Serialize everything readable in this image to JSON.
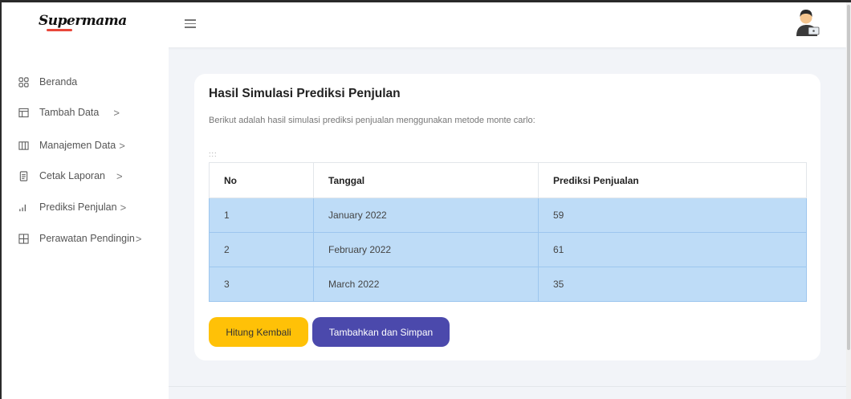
{
  "brand": {
    "logo_text": "Supermama",
    "accent": "#e8473a"
  },
  "topbar": {
    "menu_icon": "hamburger-icon",
    "avatar_icon": "user-avatar-icon"
  },
  "sidebar": {
    "items": [
      {
        "label": "Beranda",
        "icon": "grid-icon",
        "chevron": ""
      },
      {
        "label": "Tambah Data",
        "icon": "layout-icon",
        "chevron": ">"
      },
      {
        "label": "Manajemen Data",
        "icon": "columns-icon",
        "chevron": ">"
      },
      {
        "label": "Cetak Laporan",
        "icon": "document-icon",
        "chevron": ">"
      },
      {
        "label": "Prediksi Penjulan",
        "icon": "bar-chart-icon",
        "chevron": ">"
      },
      {
        "label": "Perawatan Pendingin",
        "icon": "table-grid-icon",
        "chevron": ">"
      }
    ]
  },
  "main": {
    "title": "Hasil Simulasi Prediksi Penjulan",
    "subtitle": "Berikut adalah hasil simulasi prediksi penjualan menggunakan metode monte carlo:",
    "drag_handle": ":::",
    "table": {
      "headers": [
        "No",
        "Tanggal",
        "Prediksi Penjualan"
      ],
      "rows": [
        [
          "1",
          "January 2022",
          "59"
        ],
        [
          "2",
          "February 2022",
          "61"
        ],
        [
          "3",
          "March 2022",
          "35"
        ]
      ]
    },
    "buttons": {
      "recalculate": "Hitung Kembali",
      "save": "Tambahkan dan Simpan"
    }
  },
  "colors": {
    "primary": "#4b49ac",
    "warning": "#ffc107",
    "row_highlight": "#bedcf7"
  }
}
